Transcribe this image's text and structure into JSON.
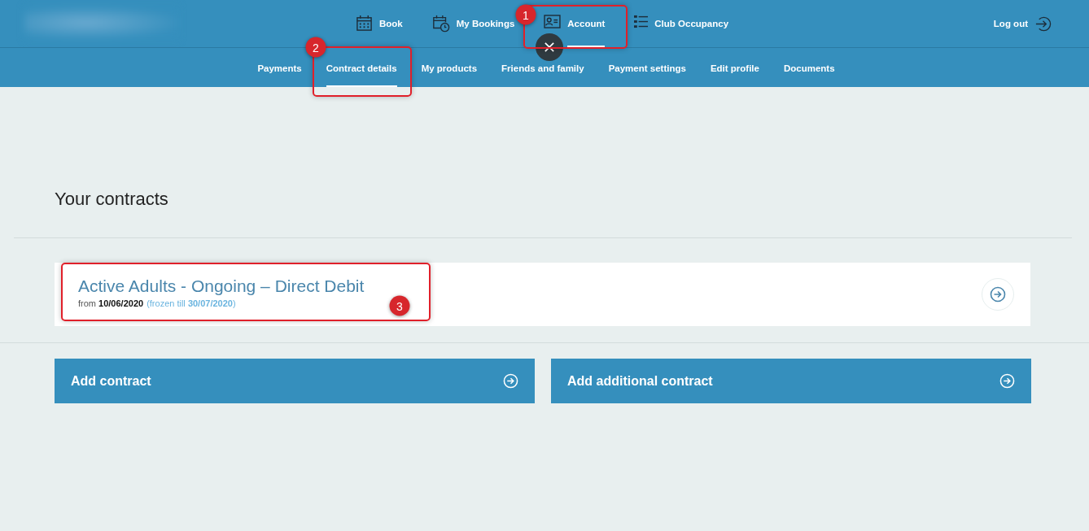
{
  "nav": {
    "items": [
      {
        "label": "Book",
        "selected": false
      },
      {
        "label": "My Bookings",
        "selected": false
      },
      {
        "label": "Account",
        "selected": true
      },
      {
        "label": "Club Occupancy",
        "selected": false
      }
    ],
    "logout": "Log out"
  },
  "subnav": {
    "items": [
      {
        "label": "Payments",
        "selected": false
      },
      {
        "label": "Contract details",
        "selected": true
      },
      {
        "label": "My products",
        "selected": false
      },
      {
        "label": "Friends and family",
        "selected": false
      },
      {
        "label": "Payment settings",
        "selected": false
      },
      {
        "label": "Edit profile",
        "selected": false
      },
      {
        "label": "Documents",
        "selected": false
      }
    ]
  },
  "heading": "Your contracts",
  "contracts": [
    {
      "title": "Active Adults - Ongoing – Direct Debit",
      "start": "from **10/06/2020**",
      "frozen": "(frozen till **30/07/2020**)"
    }
  ],
  "actions": [
    {
      "label": "Add contract"
    },
    {
      "label": "Add additional contract"
    }
  ],
  "annotations": [
    {
      "number": "1"
    },
    {
      "number": "2"
    },
    {
      "number": "3"
    }
  ]
}
